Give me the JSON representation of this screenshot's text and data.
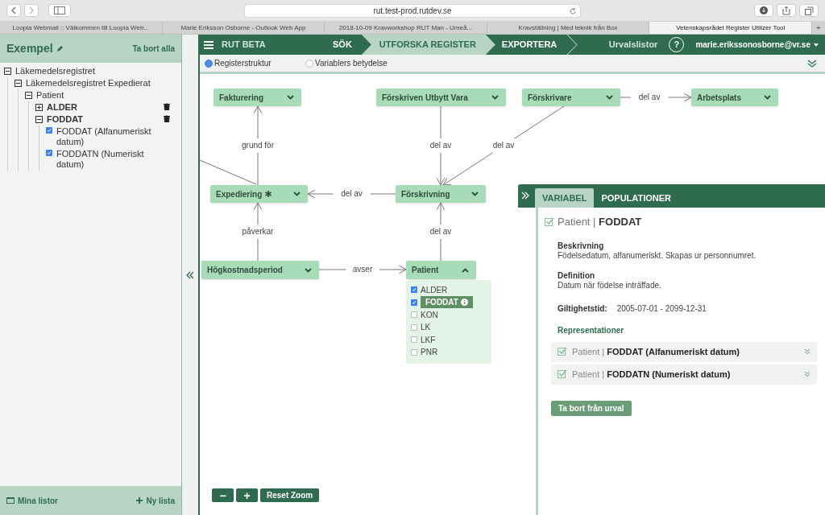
{
  "browser": {
    "url": "rut.test-prod.rutdev.se",
    "tabs": [
      {
        "label": "Loopia Webmail :: Välkommen till Loopia Web...",
        "selected": false
      },
      {
        "label": "Marie Eriksson Osborne - Outlook Web App",
        "selected": false
      },
      {
        "label": "2018-10-09 Kravworkshop RUT Man - Umeå...",
        "selected": false
      },
      {
        "label": "Kravställning | Med teknik från Box",
        "selected": false
      },
      {
        "label": "Vetenskapsrådet Register Utilizer Tool",
        "selected": true
      }
    ],
    "new_tab": "+"
  },
  "sidebar": {
    "title": "Exempel",
    "remove_all": "Ta bort alla",
    "tree": [
      {
        "label": "Läkemedelsregistret",
        "kind": "group",
        "expanded": true,
        "children": [
          {
            "label": "Läkemedelsregistret Expedierat",
            "kind": "group",
            "expanded": true,
            "children": [
              {
                "label": "Patient",
                "kind": "group",
                "expanded": true,
                "children": [
                  {
                    "label": "ALDER",
                    "kind": "variable",
                    "expanded": false
                  },
                  {
                    "label": "FODDAT",
                    "kind": "variable",
                    "expanded": true,
                    "children": [
                      {
                        "label": "FODDAT (Alfanumeriskt datum)",
                        "kind": "representation",
                        "checked": true
                      },
                      {
                        "label": "FODDATN (Numeriskt datum)",
                        "kind": "representation",
                        "checked": true
                      }
                    ]
                  }
                ]
              }
            ]
          }
        ]
      }
    ],
    "my_lists": "Mina listor",
    "new_list": "Ny lista"
  },
  "nav": {
    "brand": "RUT BETA",
    "steps": [
      {
        "label": "SÖK",
        "selected": false
      },
      {
        "label": "UTFORSKA REGISTER",
        "selected": true
      },
      {
        "label": "EXPORTERA",
        "selected": false
      }
    ],
    "lists": "Urvalslistor",
    "help": "?",
    "user": "marie.erikssonosborne@vr.se"
  },
  "view_options": [
    {
      "label": "Registerstruktur",
      "selected": true
    },
    {
      "label": "Variablers betydelse",
      "selected": false
    }
  ],
  "diagram": {
    "nodes": [
      {
        "name": "Fakturering",
        "expanded": false,
        "marked": false
      },
      {
        "name": "Förskriven Utbytt Vara",
        "expanded": false,
        "marked": false
      },
      {
        "name": "Förskrivare",
        "expanded": false,
        "marked": false
      },
      {
        "name": "Arbetsplats",
        "expanded": false,
        "marked": false
      },
      {
        "name": "Expediering",
        "expanded": false,
        "marked": true
      },
      {
        "name": "Förskrivning",
        "expanded": false,
        "marked": false
      },
      {
        "name": "Högkostnadsperiod",
        "expanded": false,
        "marked": false
      },
      {
        "name": "Patient",
        "expanded": true,
        "marked": false,
        "variables": [
          {
            "name": "ALDER",
            "checked": true,
            "selected": false
          },
          {
            "name": "FODDAT",
            "checked": true,
            "selected": true
          },
          {
            "name": "KON",
            "checked": false,
            "selected": false
          },
          {
            "name": "LK",
            "checked": false,
            "selected": false
          },
          {
            "name": "LKF",
            "checked": false,
            "selected": false
          },
          {
            "name": "PNR",
            "checked": false,
            "selected": false
          }
        ]
      }
    ],
    "edges": [
      {
        "label": "grund för"
      },
      {
        "label": "del av"
      },
      {
        "label": "del av"
      },
      {
        "label": "del av"
      },
      {
        "label": "del av"
      },
      {
        "label": "påverkar"
      },
      {
        "label": "del av"
      },
      {
        "label": "avser"
      }
    ],
    "zoom_controls": [
      "−",
      "+",
      "Reset Zoom"
    ]
  },
  "detail_panel": {
    "tabs": [
      {
        "label": "VARIABEL",
        "selected": true
      },
      {
        "label": "POPULATIONER",
        "selected": false
      }
    ],
    "title": "Patient | **FODDAT**",
    "sections": [
      {
        "heading": "Beskrivning",
        "text": "Födelsedatum, alfanumeriskt. Skapas ur personnumret."
      },
      {
        "heading": "Definition",
        "text": "Datum när födelse inträffade."
      }
    ],
    "validity_label": "Giltighetstid:",
    "validity": "2005-07-01 - 2099-12-31",
    "representations_heading": "Representationer",
    "representations": [
      {
        "title": "Patient | **FODDAT (Alfanumeriskt datum)**",
        "checked": true
      },
      {
        "title": "Patient | **FODDATN (Numeriskt datum)**",
        "checked": true
      }
    ],
    "remove_button": "Ta bort från urval"
  }
}
